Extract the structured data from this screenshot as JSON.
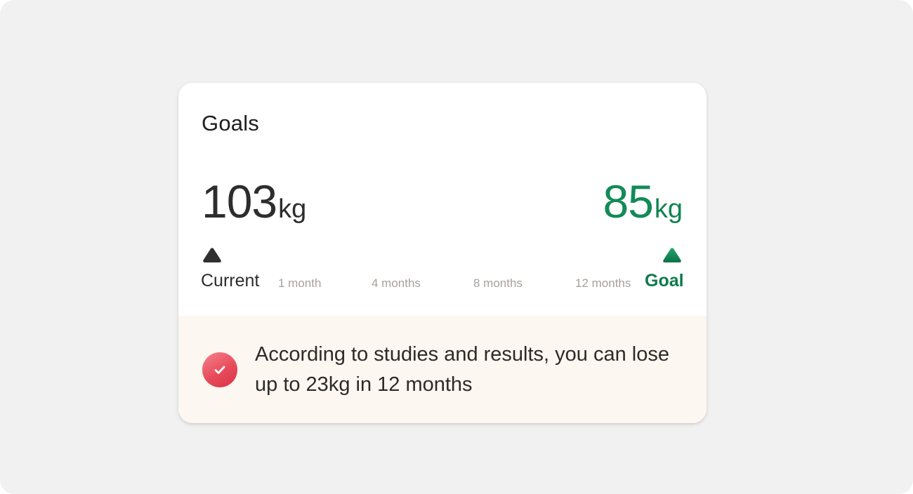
{
  "card": {
    "title": "Goals",
    "current": {
      "value": "103",
      "unit": "kg",
      "label": "Current"
    },
    "goal": {
      "value": "85",
      "unit": "kg",
      "label": "Goal"
    },
    "timeline_ticks": [
      "1 month",
      "4 months",
      "8 months",
      "12 months"
    ],
    "footer_text": "According to studies and results, you can lose up to 23kg in 12 months"
  },
  "icons": {
    "current_marker": "triangle-up-icon",
    "goal_marker": "triangle-up-icon",
    "footer_badge": "check-icon"
  },
  "colors": {
    "current": "#2d2d2d",
    "goal": "#138a58",
    "badge": "#e84b5a",
    "footer_bg": "#fcf7f1"
  }
}
